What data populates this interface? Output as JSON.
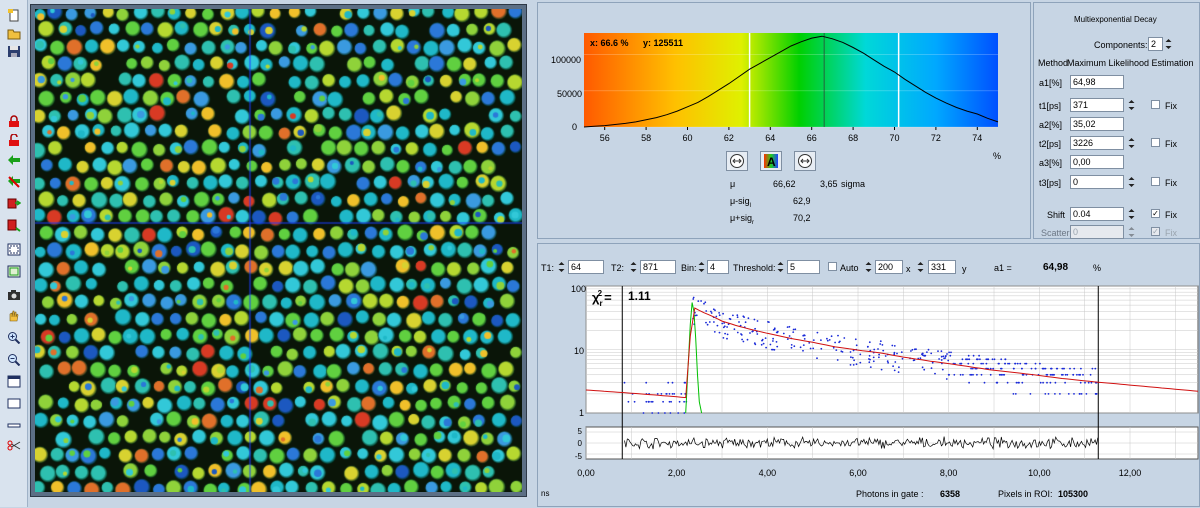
{
  "toolbar": {
    "icons": [
      "new-file-icon",
      "open-folder-icon",
      "save-icon",
      "lock-icon",
      "unlock-icon",
      "green-arrow-icon",
      "crossed-arrow-icon",
      "stack-red-icon",
      "stack-red-2-icon",
      "select-frame-icon",
      "select-frame-green-icon",
      "camera-icon",
      "hand-icon",
      "zoom-in-icon",
      "zoom-out-icon",
      "window-icon",
      "rectangle-icon",
      "line-icon",
      "scissors-icon"
    ]
  },
  "histogram": {
    "readout_x": "x: 66.6 %",
    "readout_y": "y: 125511",
    "y_ticks": [
      "100000",
      "50000",
      "0"
    ],
    "x_ticks": [
      "56",
      "58",
      "60",
      "62",
      "64",
      "66",
      "68",
      "70",
      "72",
      "74"
    ],
    "x_unit": "%",
    "stats": {
      "mu_label": "μ",
      "mu_value": "66,62",
      "sigma_value": "3,65",
      "sigma_label": "sigma",
      "mu_minus_label": "μ-sig",
      "mu_minus_sub": "l",
      "mu_minus_value": "62,9",
      "mu_plus_label": "μ+sig",
      "mu_plus_sub": "r",
      "mu_plus_value": "70,2"
    }
  },
  "decay_settings": {
    "title": "Multiexponential Decay",
    "components_label": "Components:",
    "components_value": "2",
    "method_label": "Method",
    "method_value": "Maximum Likelihood Estimation",
    "params": [
      {
        "label": "a1[%]",
        "value": "64,98"
      },
      {
        "label": "t1[ps]",
        "value": "371",
        "fix": "Fix"
      },
      {
        "label": "a2[%]",
        "value": "35,02"
      },
      {
        "label": "t2[ps]",
        "value": "3226",
        "fix": "Fix"
      },
      {
        "label": "a3[%]",
        "value": "0,00"
      },
      {
        "label": "t3[ps]",
        "value": "0",
        "fix": "Fix"
      }
    ],
    "shift_label": "Shift",
    "shift_value": "0.04",
    "shift_fix": "Fix",
    "scatter_label": "Scatter",
    "scatter_value": "0",
    "scatter_fix": "Fix"
  },
  "decay": {
    "t1_label": "T1:",
    "t1_value": "64",
    "t2_label": "T2:",
    "t2_value": "871",
    "bin_label": "Bin:",
    "bin_value": "4",
    "threshold_label": "Threshold:",
    "threshold_value": "5",
    "auto_label": "Auto",
    "x_value": "200",
    "x_label": "x",
    "y_value": "331",
    "y_label": "y",
    "a1_label": "a1 =",
    "a1_value": "64,98",
    "a1_unit": "%",
    "chi_label": "χ",
    "chi_sub": "r",
    "chi_sup": "2",
    "chi_eq": "=",
    "chi_value": "1.11",
    "log_ticks": [
      "100",
      "10",
      "1"
    ],
    "res_ticks": [
      "5",
      "0",
      "-5"
    ],
    "x_ticks": [
      "0,00",
      "2,00",
      "4,00",
      "6,00",
      "8,00",
      "10,00",
      "12,00"
    ],
    "x_unit": "ns",
    "photons_label": "Photons in gate :",
    "photons_value": "6358",
    "pixels_label": "Pixels in ROI:",
    "pixels_value": "105300"
  },
  "chart_data": [
    {
      "type": "area",
      "title": "",
      "xlabel": "%",
      "ylabel": "",
      "xlim": [
        55,
        75
      ],
      "ylim": [
        0,
        130000
      ],
      "colormap": [
        "#ff6a00",
        "#ffe600",
        "#00d000",
        "#00c8ff",
        "#0060ff"
      ],
      "cursor_lines": [
        63,
        66.6,
        70.2
      ],
      "x": [
        55.0,
        55.5,
        56.0,
        56.5,
        57.0,
        57.5,
        58.0,
        58.5,
        59.0,
        59.5,
        60.0,
        60.5,
        61.0,
        61.5,
        62.0,
        62.5,
        63.0,
        63.5,
        64.0,
        64.5,
        65.0,
        65.5,
        66.0,
        66.5,
        67.0,
        67.5,
        68.0,
        68.5,
        69.0,
        69.5,
        70.0,
        70.5,
        71.0,
        71.5,
        72.0,
        72.5,
        73.0,
        73.5,
        74.0,
        74.5,
        75.0
      ],
      "y": [
        0,
        1000,
        2000,
        3500,
        5000,
        7000,
        10000,
        13000,
        17000,
        22000,
        28000,
        34000,
        42000,
        51000,
        60000,
        70000,
        80000,
        88000,
        96000,
        104000,
        112000,
        118000,
        123000,
        125511,
        122000,
        117000,
        110000,
        102000,
        93000,
        84000,
        76000,
        66000,
        57000,
        48000,
        40000,
        33000,
        27000,
        22000,
        18000,
        12000,
        7000
      ]
    },
    {
      "type": "scatter",
      "title": "",
      "xlabel": "ns",
      "ylabel": "",
      "xlim": [
        0,
        13.5
      ],
      "ylim": [
        1,
        100
      ],
      "y_scale": "log",
      "cursor_lines": [
        0.8,
        11.3
      ],
      "series": [
        {
          "values_x": [
            2.4,
            2.6,
            2.8,
            3.0,
            3.3,
            3.6,
            4.0,
            4.5,
            5.0,
            5.5,
            6.0,
            6.5,
            7.0,
            7.5,
            8.0,
            8.5,
            9.0,
            9.5,
            10.0,
            10.5,
            11.0
          ],
          "values_y": [
            45,
            38,
            33,
            28,
            24,
            21,
            18,
            15,
            13,
            11,
            9.8,
            8.8,
            7.6,
            6.7,
            6.0,
            5.3,
            4.7,
            4.3,
            3.9,
            3.5,
            3.2
          ]
        }
      ]
    }
  ]
}
